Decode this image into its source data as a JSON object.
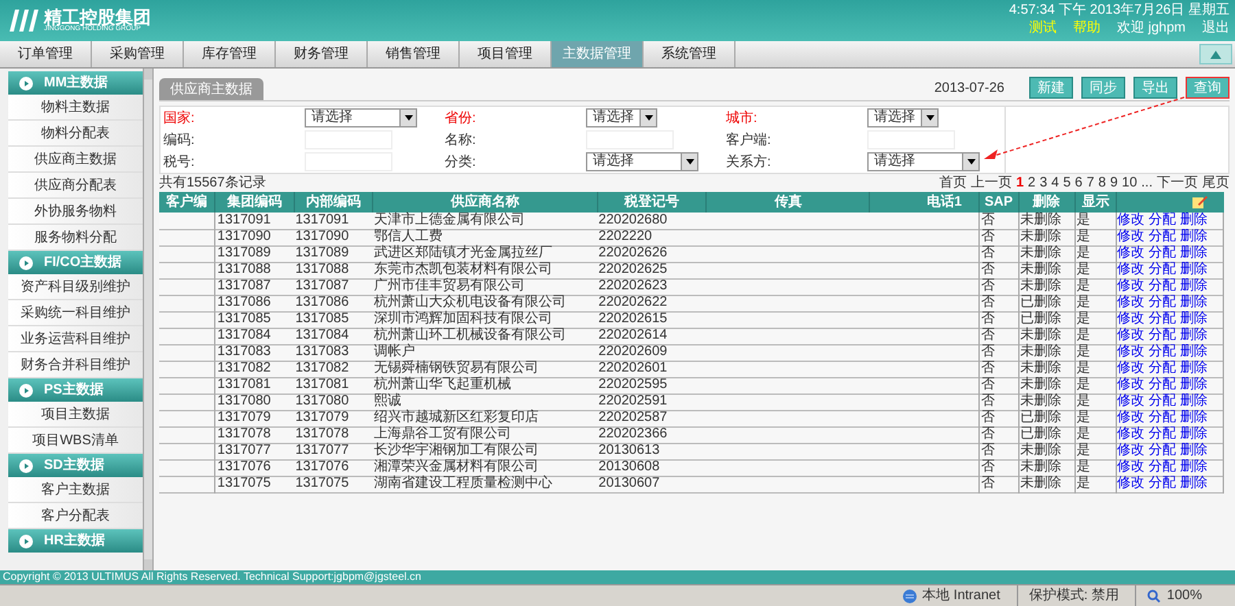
{
  "header": {
    "logo_text": "精工控股集团",
    "logo_subtext": "JINGGONG HOLDING GROUP",
    "datetime": "4:57:34 下午  2013年7月26日 星期五",
    "links": [
      "测试",
      "帮助"
    ],
    "welcome": "欢迎 jghpm",
    "logout": "退出"
  },
  "nav": [
    {
      "label": "订单管理",
      "selected": false
    },
    {
      "label": "采购管理",
      "selected": false
    },
    {
      "label": "库存管理",
      "selected": false
    },
    {
      "label": "财务管理",
      "selected": false
    },
    {
      "label": "销售管理",
      "selected": false
    },
    {
      "label": "项目管理",
      "selected": false
    },
    {
      "label": "主数据管理",
      "selected": true
    },
    {
      "label": "系统管理",
      "selected": false
    }
  ],
  "sidebar": [
    {
      "title": "MM主数据",
      "children": [
        "物料主数据",
        "物料分配表",
        "供应商主数据",
        "供应商分配表",
        "外协服务物料",
        "服务物料分配"
      ]
    },
    {
      "title": "FI/CO主数据",
      "children": [
        "资产科目级别维护",
        "采购统一科目维护",
        "业务运营科目维护",
        "财务合并科目维护"
      ]
    },
    {
      "title": "PS主数据",
      "children": [
        "项目主数据",
        "项目WBS清单"
      ]
    },
    {
      "title": "SD主数据",
      "children": [
        "客户主数据",
        "客户分配表"
      ]
    },
    {
      "title": "HR主数据"
    }
  ],
  "tab": "供应商主数据",
  "date": "2013-07-26",
  "buttons": [
    "新建",
    "同步",
    "导出",
    "查询"
  ],
  "filters": [
    {
      "label": "国家:",
      "required": true,
      "kind": "select",
      "value": "请选择"
    },
    {
      "label": "省份:",
      "required": true,
      "kind": "select",
      "value": "请选择"
    },
    {
      "label": "城市:",
      "required": true,
      "kind": "select",
      "value": "请选择"
    },
    {
      "label": "编码:",
      "required": false,
      "kind": "input"
    },
    {
      "label": "名称:",
      "required": false,
      "kind": "input"
    },
    {
      "label": "客户端:",
      "required": false,
      "kind": "input"
    },
    {
      "label": "税号:",
      "required": false,
      "kind": "input"
    },
    {
      "label": "分类:",
      "required": false,
      "kind": "select",
      "value": "请选择"
    },
    {
      "label": "关系方:",
      "required": false,
      "kind": "select",
      "value": "请选择"
    }
  ],
  "record_count": "共有15567条记录",
  "pagination": {
    "first": "首页",
    "prev": "上一页",
    "pages": [
      {
        "label": "1",
        "selected": true
      },
      {
        "label": "2",
        "selected": false
      },
      {
        "label": "3",
        "selected": false
      },
      {
        "label": "4",
        "selected": false
      },
      {
        "label": "5",
        "selected": false
      },
      {
        "label": "6",
        "selected": false
      },
      {
        "label": "7",
        "selected": false
      },
      {
        "label": "8",
        "selected": false
      },
      {
        "label": "9",
        "selected": false
      },
      {
        "label": "10",
        "selected": false
      }
    ],
    "ellipsis": "...",
    "next": "下一页",
    "last": "尾页"
  },
  "table": {
    "columns": [
      "客户编",
      "集团编码",
      "内部编码",
      "供应商名称",
      "税登记号",
      "传真",
      "电话1",
      "SAP",
      "删除",
      "显示"
    ],
    "rows": [
      {
        "cells": [
          "",
          "1317091",
          "1317091",
          "天津市上德金属有限公司",
          "220202680",
          "",
          "",
          "否",
          "未删除",
          "是"
        ],
        "actions": [
          "修改",
          "分配",
          "删除"
        ]
      },
      {
        "cells": [
          "",
          "1317090",
          "1317090",
          "鄂信人工费",
          "2202220",
          "",
          "",
          "否",
          "未删除",
          "是"
        ],
        "actions": [
          "修改",
          "分配",
          "删除"
        ]
      },
      {
        "cells": [
          "",
          "1317089",
          "1317089",
          "武进区郑陆镇才光金属拉丝厂",
          "220202626",
          "",
          "",
          "否",
          "未删除",
          "是"
        ],
        "actions": [
          "修改",
          "分配",
          "删除"
        ]
      },
      {
        "cells": [
          "",
          "1317088",
          "1317088",
          "东莞市杰凯包装材料有限公司",
          "220202625",
          "",
          "",
          "否",
          "未删除",
          "是"
        ],
        "actions": [
          "修改",
          "分配",
          "删除"
        ]
      },
      {
        "cells": [
          "",
          "1317087",
          "1317087",
          "广州市佳丰贸易有限公司",
          "220202623",
          "",
          "",
          "否",
          "未删除",
          "是"
        ],
        "actions": [
          "修改",
          "分配",
          "删除"
        ]
      },
      {
        "cells": [
          "",
          "1317086",
          "1317086",
          "杭州萧山大众机电设备有限公司",
          "220202622",
          "",
          "",
          "否",
          "已删除",
          "是"
        ],
        "actions": [
          "修改",
          "分配",
          "删除"
        ]
      },
      {
        "cells": [
          "",
          "1317085",
          "1317085",
          "深圳市鸿辉加固科技有限公司",
          "220202615",
          "",
          "",
          "否",
          "已删除",
          "是"
        ],
        "actions": [
          "修改",
          "分配",
          "删除"
        ]
      },
      {
        "cells": [
          "",
          "1317084",
          "1317084",
          "杭州萧山环工机械设备有限公司",
          "220202614",
          "",
          "",
          "否",
          "未删除",
          "是"
        ],
        "actions": [
          "修改",
          "分配",
          "删除"
        ]
      },
      {
        "cells": [
          "",
          "1317083",
          "1317083",
          "调帐户",
          "220202609",
          "",
          "",
          "否",
          "未删除",
          "是"
        ],
        "actions": [
          "修改",
          "分配",
          "删除"
        ]
      },
      {
        "cells": [
          "",
          "1317082",
          "1317082",
          "无锡舜楠钢铁贸易有限公司",
          "220202601",
          "",
          "",
          "否",
          "未删除",
          "是"
        ],
        "actions": [
          "修改",
          "分配",
          "删除"
        ]
      },
      {
        "cells": [
          "",
          "1317081",
          "1317081",
          "杭州萧山华飞起重机械",
          "220202595",
          "",
          "",
          "否",
          "未删除",
          "是"
        ],
        "actions": [
          "修改",
          "分配",
          "删除"
        ]
      },
      {
        "cells": [
          "",
          "1317080",
          "1317080",
          "熙诚",
          "220202591",
          "",
          "",
          "否",
          "未删除",
          "是"
        ],
        "actions": [
          "修改",
          "分配",
          "删除"
        ]
      },
      {
        "cells": [
          "",
          "1317079",
          "1317079",
          "绍兴市越城新区红彩复印店",
          "220202587",
          "",
          "",
          "否",
          "已删除",
          "是"
        ],
        "actions": [
          "修改",
          "分配",
          "删除"
        ]
      },
      {
        "cells": [
          "",
          "1317078",
          "1317078",
          "上海鼎谷工贸有限公司",
          "220202366",
          "",
          "",
          "否",
          "已删除",
          "是"
        ],
        "actions": [
          "修改",
          "分配",
          "删除"
        ]
      },
      {
        "cells": [
          "",
          "1317077",
          "1317077",
          "长沙华宇湘钢加工有限公司",
          "20130613",
          "",
          "",
          "否",
          "未删除",
          "是"
        ],
        "actions": [
          "修改",
          "分配",
          "删除"
        ]
      },
      {
        "cells": [
          "",
          "1317076",
          "1317076",
          "湘潭荣兴金属材料有限公司",
          "20130608",
          "",
          "",
          "否",
          "未删除",
          "是"
        ],
        "actions": [
          "修改",
          "分配",
          "删除"
        ]
      },
      {
        "cells": [
          "",
          "1317075",
          "1317075",
          "湖南省建设工程质量检测中心",
          "20130607",
          "",
          "",
          "否",
          "未删除",
          "是"
        ],
        "actions": [
          "修改",
          "分配",
          "删除"
        ]
      }
    ]
  },
  "copyright": "Copyright © 2013 ULTIMUS All Rights Reserved. Technical Support:jgbpm@jgsteel.cn",
  "status_bar": {
    "zone": "本地 Intranet",
    "protected_mode": "保护模式: 禁用",
    "zoom": "100%"
  }
}
